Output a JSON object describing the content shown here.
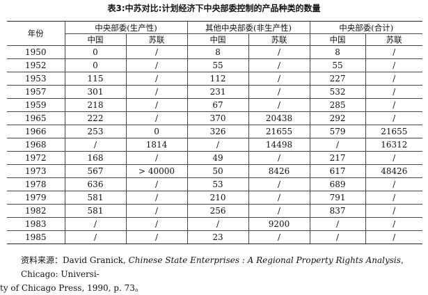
{
  "title": "表3:中苏对比:计划经济下中央部委控制的产品种类的数量",
  "table": {
    "year_header": "年份",
    "groups": [
      "中央部委(生产性)",
      "其他中央部委(非生产性)",
      "中央部委(合计)"
    ],
    "sub_headers": [
      "中国",
      "苏联",
      "中国",
      "苏联",
      "中国",
      "苏联"
    ],
    "rows": [
      [
        "1950",
        "0",
        "/",
        "8",
        "/",
        "8",
        "/"
      ],
      [
        "1952",
        "0",
        "/",
        "55",
        "/",
        "55",
        "/"
      ],
      [
        "1953",
        "115",
        "/",
        "112",
        "/",
        "227",
        "/"
      ],
      [
        "1957",
        "301",
        "/",
        "231",
        "/",
        "532",
        "/"
      ],
      [
        "1959",
        "218",
        "/",
        "67",
        "/",
        "285",
        "/"
      ],
      [
        "1965",
        "222",
        "/",
        "370",
        "20438",
        "292",
        "/"
      ],
      [
        "1966",
        "253",
        "0",
        "326",
        "21655",
        "579",
        "21655"
      ],
      [
        "1968",
        "/",
        "1814",
        "/",
        "14498",
        "/",
        "16312"
      ],
      [
        "1972",
        "168",
        "/",
        "49",
        "/",
        "217",
        "/"
      ],
      [
        "1973",
        "567",
        "> 40000",
        "50",
        "8426",
        "617",
        "48426"
      ],
      [
        "1978",
        "636",
        "/",
        "53",
        "/",
        "689",
        "/"
      ],
      [
        "1979",
        "581",
        "/",
        "210",
        "/",
        "791",
        "/"
      ],
      [
        "1982",
        "581",
        "/",
        "256",
        "/",
        "837",
        "/"
      ],
      [
        "1983",
        "/",
        "/",
        "/",
        "9200",
        "/",
        "/"
      ],
      [
        "1985",
        "/",
        "/",
        "23",
        "/",
        "/",
        "/"
      ]
    ]
  },
  "source": {
    "label": "资料来源：",
    "author": "David Granick, ",
    "book_title": "Chinese State Enterprises : A Regional Property Rights Analysis",
    "line1_rest": ", Chicago: Universi-",
    "line2": "ty of Chicago Press, 1990, p. 73。"
  }
}
